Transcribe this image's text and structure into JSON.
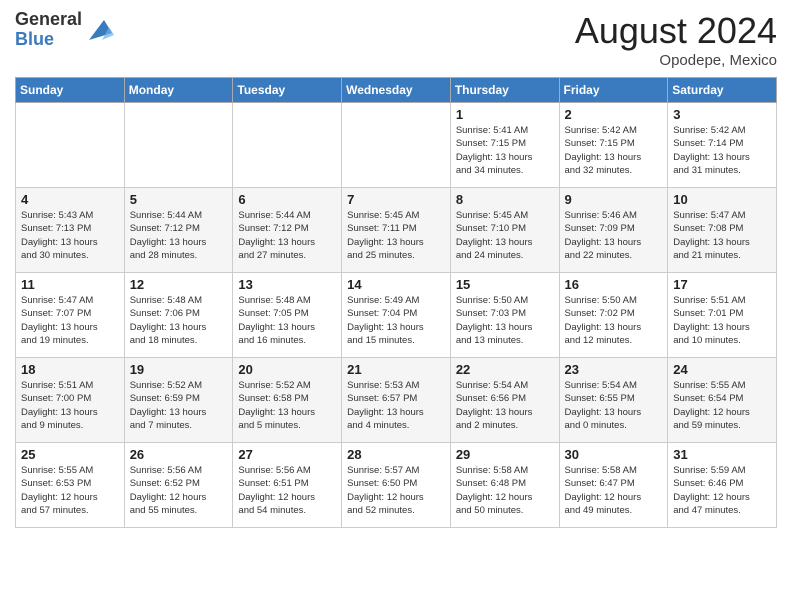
{
  "header": {
    "logo_general": "General",
    "logo_blue": "Blue",
    "title": "August 2024",
    "location": "Opodepe, Mexico"
  },
  "days_of_week": [
    "Sunday",
    "Monday",
    "Tuesday",
    "Wednesday",
    "Thursday",
    "Friday",
    "Saturday"
  ],
  "weeks": [
    [
      {
        "day": "",
        "content": ""
      },
      {
        "day": "",
        "content": ""
      },
      {
        "day": "",
        "content": ""
      },
      {
        "day": "",
        "content": ""
      },
      {
        "day": "1",
        "content": "Sunrise: 5:41 AM\nSunset: 7:15 PM\nDaylight: 13 hours\nand 34 minutes."
      },
      {
        "day": "2",
        "content": "Sunrise: 5:42 AM\nSunset: 7:15 PM\nDaylight: 13 hours\nand 32 minutes."
      },
      {
        "day": "3",
        "content": "Sunrise: 5:42 AM\nSunset: 7:14 PM\nDaylight: 13 hours\nand 31 minutes."
      }
    ],
    [
      {
        "day": "4",
        "content": "Sunrise: 5:43 AM\nSunset: 7:13 PM\nDaylight: 13 hours\nand 30 minutes."
      },
      {
        "day": "5",
        "content": "Sunrise: 5:44 AM\nSunset: 7:12 PM\nDaylight: 13 hours\nand 28 minutes."
      },
      {
        "day": "6",
        "content": "Sunrise: 5:44 AM\nSunset: 7:12 PM\nDaylight: 13 hours\nand 27 minutes."
      },
      {
        "day": "7",
        "content": "Sunrise: 5:45 AM\nSunset: 7:11 PM\nDaylight: 13 hours\nand 25 minutes."
      },
      {
        "day": "8",
        "content": "Sunrise: 5:45 AM\nSunset: 7:10 PM\nDaylight: 13 hours\nand 24 minutes."
      },
      {
        "day": "9",
        "content": "Sunrise: 5:46 AM\nSunset: 7:09 PM\nDaylight: 13 hours\nand 22 minutes."
      },
      {
        "day": "10",
        "content": "Sunrise: 5:47 AM\nSunset: 7:08 PM\nDaylight: 13 hours\nand 21 minutes."
      }
    ],
    [
      {
        "day": "11",
        "content": "Sunrise: 5:47 AM\nSunset: 7:07 PM\nDaylight: 13 hours\nand 19 minutes."
      },
      {
        "day": "12",
        "content": "Sunrise: 5:48 AM\nSunset: 7:06 PM\nDaylight: 13 hours\nand 18 minutes."
      },
      {
        "day": "13",
        "content": "Sunrise: 5:48 AM\nSunset: 7:05 PM\nDaylight: 13 hours\nand 16 minutes."
      },
      {
        "day": "14",
        "content": "Sunrise: 5:49 AM\nSunset: 7:04 PM\nDaylight: 13 hours\nand 15 minutes."
      },
      {
        "day": "15",
        "content": "Sunrise: 5:50 AM\nSunset: 7:03 PM\nDaylight: 13 hours\nand 13 minutes."
      },
      {
        "day": "16",
        "content": "Sunrise: 5:50 AM\nSunset: 7:02 PM\nDaylight: 13 hours\nand 12 minutes."
      },
      {
        "day": "17",
        "content": "Sunrise: 5:51 AM\nSunset: 7:01 PM\nDaylight: 13 hours\nand 10 minutes."
      }
    ],
    [
      {
        "day": "18",
        "content": "Sunrise: 5:51 AM\nSunset: 7:00 PM\nDaylight: 13 hours\nand 9 minutes."
      },
      {
        "day": "19",
        "content": "Sunrise: 5:52 AM\nSunset: 6:59 PM\nDaylight: 13 hours\nand 7 minutes."
      },
      {
        "day": "20",
        "content": "Sunrise: 5:52 AM\nSunset: 6:58 PM\nDaylight: 13 hours\nand 5 minutes."
      },
      {
        "day": "21",
        "content": "Sunrise: 5:53 AM\nSunset: 6:57 PM\nDaylight: 13 hours\nand 4 minutes."
      },
      {
        "day": "22",
        "content": "Sunrise: 5:54 AM\nSunset: 6:56 PM\nDaylight: 13 hours\nand 2 minutes."
      },
      {
        "day": "23",
        "content": "Sunrise: 5:54 AM\nSunset: 6:55 PM\nDaylight: 13 hours\nand 0 minutes."
      },
      {
        "day": "24",
        "content": "Sunrise: 5:55 AM\nSunset: 6:54 PM\nDaylight: 12 hours\nand 59 minutes."
      }
    ],
    [
      {
        "day": "25",
        "content": "Sunrise: 5:55 AM\nSunset: 6:53 PM\nDaylight: 12 hours\nand 57 minutes."
      },
      {
        "day": "26",
        "content": "Sunrise: 5:56 AM\nSunset: 6:52 PM\nDaylight: 12 hours\nand 55 minutes."
      },
      {
        "day": "27",
        "content": "Sunrise: 5:56 AM\nSunset: 6:51 PM\nDaylight: 12 hours\nand 54 minutes."
      },
      {
        "day": "28",
        "content": "Sunrise: 5:57 AM\nSunset: 6:50 PM\nDaylight: 12 hours\nand 52 minutes."
      },
      {
        "day": "29",
        "content": "Sunrise: 5:58 AM\nSunset: 6:48 PM\nDaylight: 12 hours\nand 50 minutes."
      },
      {
        "day": "30",
        "content": "Sunrise: 5:58 AM\nSunset: 6:47 PM\nDaylight: 12 hours\nand 49 minutes."
      },
      {
        "day": "31",
        "content": "Sunrise: 5:59 AM\nSunset: 6:46 PM\nDaylight: 12 hours\nand 47 minutes."
      }
    ]
  ]
}
